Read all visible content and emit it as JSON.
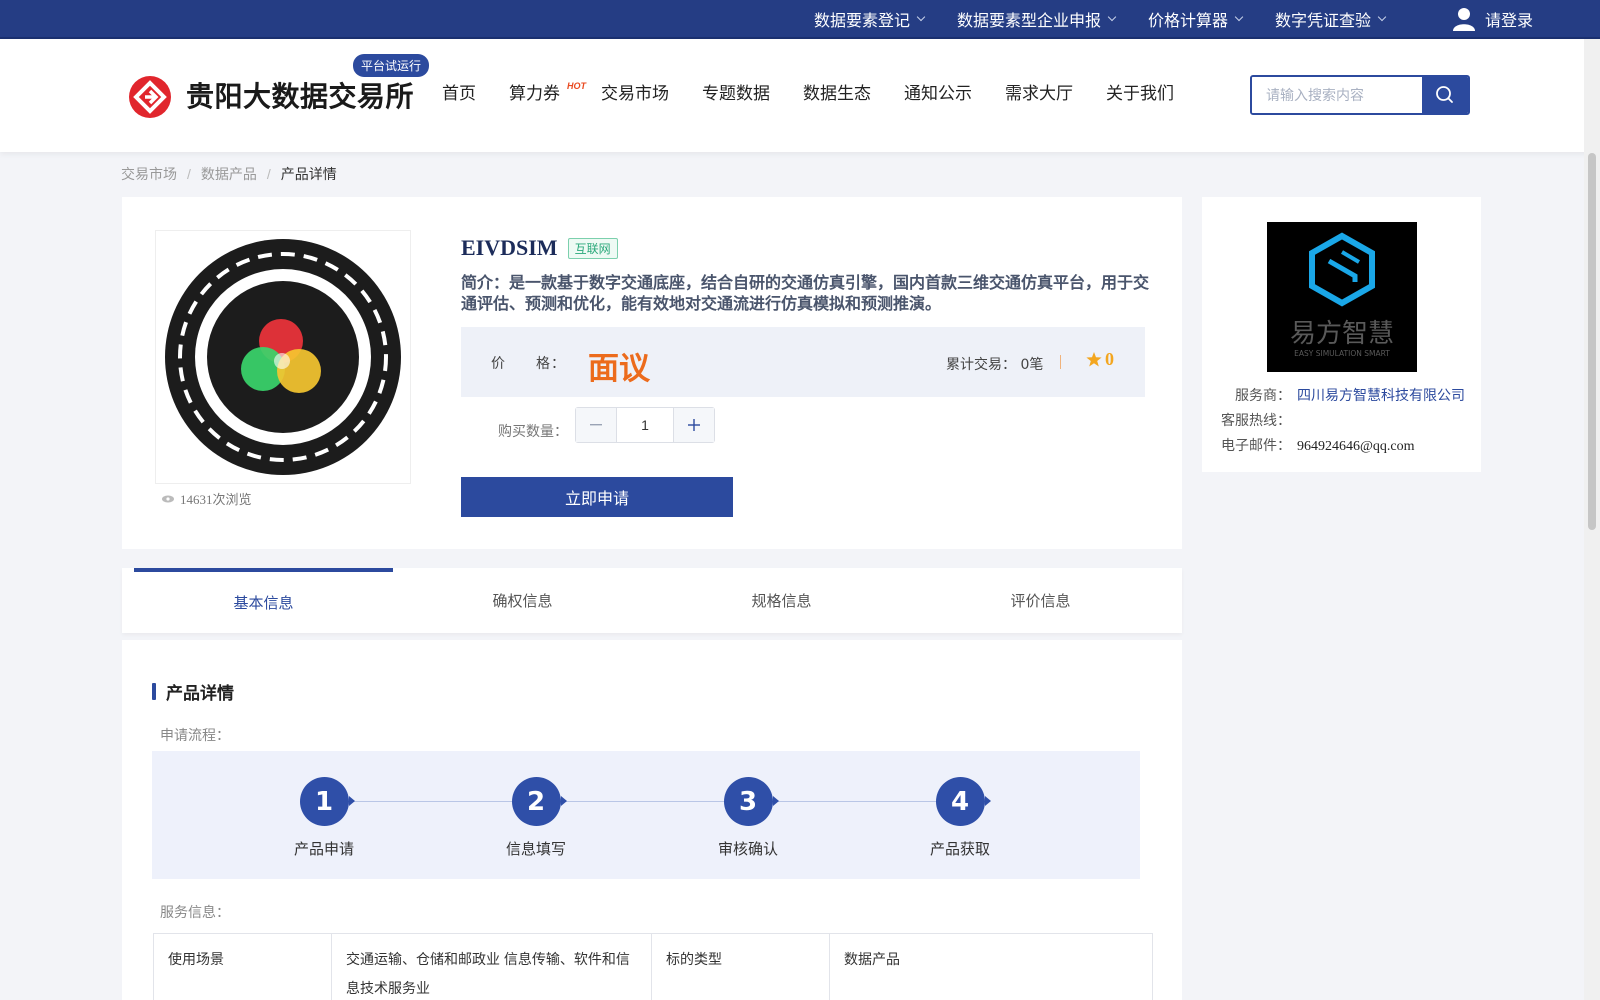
{
  "topbar": {
    "menu": [
      {
        "label": "数据要素登记"
      },
      {
        "label": "数据要素型企业申报"
      },
      {
        "label": "价格计算器"
      },
      {
        "label": "数字凭证查验"
      }
    ],
    "login_label": "请登录"
  },
  "header": {
    "brand": "贵阳大数据交易所",
    "trial_badge": "平台试运行",
    "nav": [
      {
        "label": "首页"
      },
      {
        "label": "算力券",
        "badge": "HOT"
      },
      {
        "label": "交易市场"
      },
      {
        "label": "专题数据"
      },
      {
        "label": "数据生态"
      },
      {
        "label": "通知公示"
      },
      {
        "label": "需求大厅"
      },
      {
        "label": "关于我们"
      }
    ],
    "search_placeholder": "请输入搜索内容"
  },
  "breadcrumb": [
    "交易市场",
    "数据产品",
    "产品详情"
  ],
  "product": {
    "name": "EIVDSIM",
    "tag": "互联网",
    "description": "简介：是一款基于数字交通底座，结合自研的交通仿真引擎，国内首款三维交通仿真平台，用于交通评估、预测和优化，能有效地对交通流进行仿真模拟和预测推演。",
    "views": "14631次浏览",
    "price_label": "价　　格：",
    "price_value": "面议",
    "trades_label": "累计交易：",
    "trades_value": "0笔",
    "rating": "0",
    "qty_label": "购买数量：",
    "qty_value": "1",
    "apply_label": "立即申请"
  },
  "provider": {
    "label_service": "服务商：",
    "service_name": "四川易方智慧科技有限公司",
    "label_hotline": "客服热线：",
    "hotline": "",
    "label_email": "电子邮件：",
    "email": "964924646@qq.com",
    "logo_text": "易方智慧",
    "logo_sub": "EASY SIMULATION SMART"
  },
  "tabs": [
    {
      "label": "基本信息",
      "active": true
    },
    {
      "label": "确权信息"
    },
    {
      "label": "规格信息"
    },
    {
      "label": "评价信息"
    }
  ],
  "details": {
    "title": "产品详情",
    "flow_label": "申请流程：",
    "steps": [
      {
        "num": "1",
        "label": "产品申请"
      },
      {
        "num": "2",
        "label": "信息填写"
      },
      {
        "num": "3",
        "label": "审核确认"
      },
      {
        "num": "4",
        "label": "产品获取"
      }
    ],
    "service_label": "服务信息：",
    "table": [
      [
        "使用场景",
        "交通运输、仓储和邮政业 信息传输、软件和信息技术服务业",
        "标的类型",
        "数据产品"
      ]
    ]
  },
  "colors": {
    "primary": "#2c4a9e",
    "topbar": "#253d84",
    "price": "#ec6b1c",
    "rating": "#f3a61f"
  }
}
